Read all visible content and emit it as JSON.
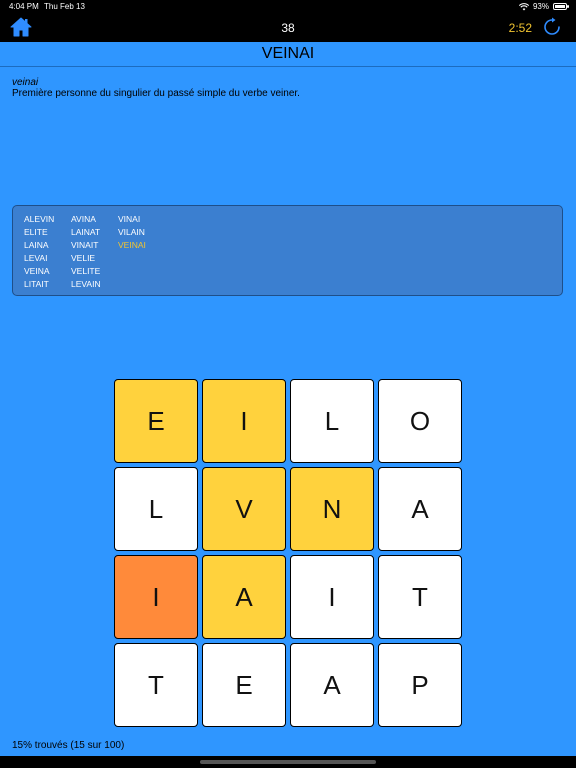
{
  "status": {
    "time": "4:04 PM",
    "date": "Thu Feb 13",
    "battery": "93%"
  },
  "header": {
    "count": "38",
    "timer": "2:52",
    "title": "VEINAI",
    "timer_color": "#f2c530"
  },
  "definition": {
    "word": "veinai",
    "text": "Première personne du singulier du passé simple du verbe veiner."
  },
  "found_words": {
    "columns": [
      [
        "ALEVIN",
        "ELITE",
        "LAINA",
        "LEVAI",
        "VEINA",
        "LITAIT"
      ],
      [
        "AVINA",
        "LAINAT",
        "VINAIT",
        "VELIE",
        "VELITE",
        "LEVAIN"
      ],
      [
        "VINAI",
        "VILAIN",
        "VEINAI"
      ]
    ]
  },
  "grid": {
    "tiles": [
      {
        "letter": "E",
        "state": "selected"
      },
      {
        "letter": "I",
        "state": "selected"
      },
      {
        "letter": "L",
        "state": "normal"
      },
      {
        "letter": "O",
        "state": "normal"
      },
      {
        "letter": "L",
        "state": "normal"
      },
      {
        "letter": "V",
        "state": "selected"
      },
      {
        "letter": "N",
        "state": "selected"
      },
      {
        "letter": "A",
        "state": "normal"
      },
      {
        "letter": "I",
        "state": "current"
      },
      {
        "letter": "A",
        "state": "selected"
      },
      {
        "letter": "I",
        "state": "normal"
      },
      {
        "letter": "T",
        "state": "normal"
      },
      {
        "letter": "T",
        "state": "normal"
      },
      {
        "letter": "E",
        "state": "normal"
      },
      {
        "letter": "A",
        "state": "normal"
      },
      {
        "letter": "P",
        "state": "normal"
      }
    ]
  },
  "footer": {
    "progress": "15% trouvés (15 sur 100)"
  },
  "colors": {
    "background": "#2f96ff",
    "selected": "#ffd23d",
    "current": "#ff8a3a",
    "panel": "#3b7fd0"
  },
  "icons": {
    "home": "home-icon",
    "refresh": "refresh-icon",
    "wifi": "wifi-icon",
    "battery": "battery-icon"
  }
}
